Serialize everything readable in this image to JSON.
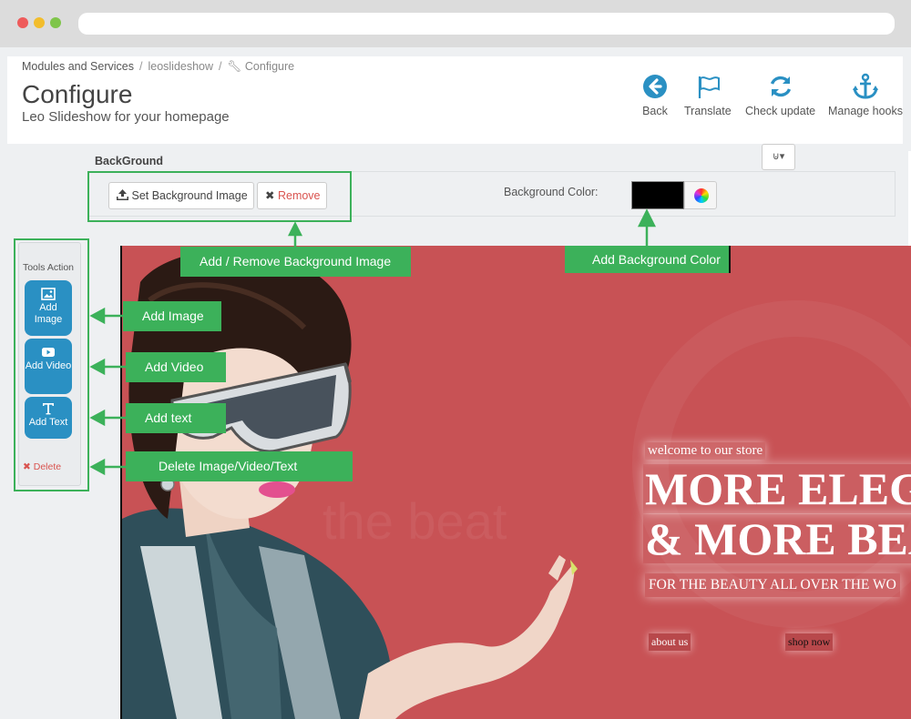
{
  "breadcrumb": {
    "item1": "Modules and Services",
    "item2": "leoslideshow",
    "item3": "Configure"
  },
  "header": {
    "title": "Configure",
    "subtitle": "Leo Slideshow for your homepage"
  },
  "toolbar": {
    "back": "Back",
    "translate": "Translate",
    "check_update": "Check update",
    "manage_hooks": "Manage hooks"
  },
  "background": {
    "section_label": "BackGround",
    "set_image_label": "Set Background Image",
    "remove_label": "Remove",
    "color_label": "Background Color:",
    "color_value": "#000000",
    "dropdown_label": "⊍▾"
  },
  "tools": {
    "title": "Tools Action",
    "add_image": "Add Image",
    "add_video": "Add Video",
    "add_text": "Add Text",
    "delete": "Delete"
  },
  "slide": {
    "welcome": "welcome to our store",
    "headline1": "MORE ELEG",
    "headline2": "& MORE BEA",
    "subline": "FOR THE BEAUTY ALL OVER THE WO",
    "link_about": "about us",
    "link_shop": "shop now",
    "background_color": "#c85255"
  },
  "callouts": {
    "bg_image": "Add / Remove Background Image",
    "bg_color": "Add Background Color",
    "image": "Add Image",
    "video": "Add Video",
    "text": "Add text",
    "delete": "Delete Image/Video/Text"
  },
  "colors": {
    "accent": "#2a90c3",
    "callout": "#3cb15a",
    "danger": "#d9534f"
  }
}
